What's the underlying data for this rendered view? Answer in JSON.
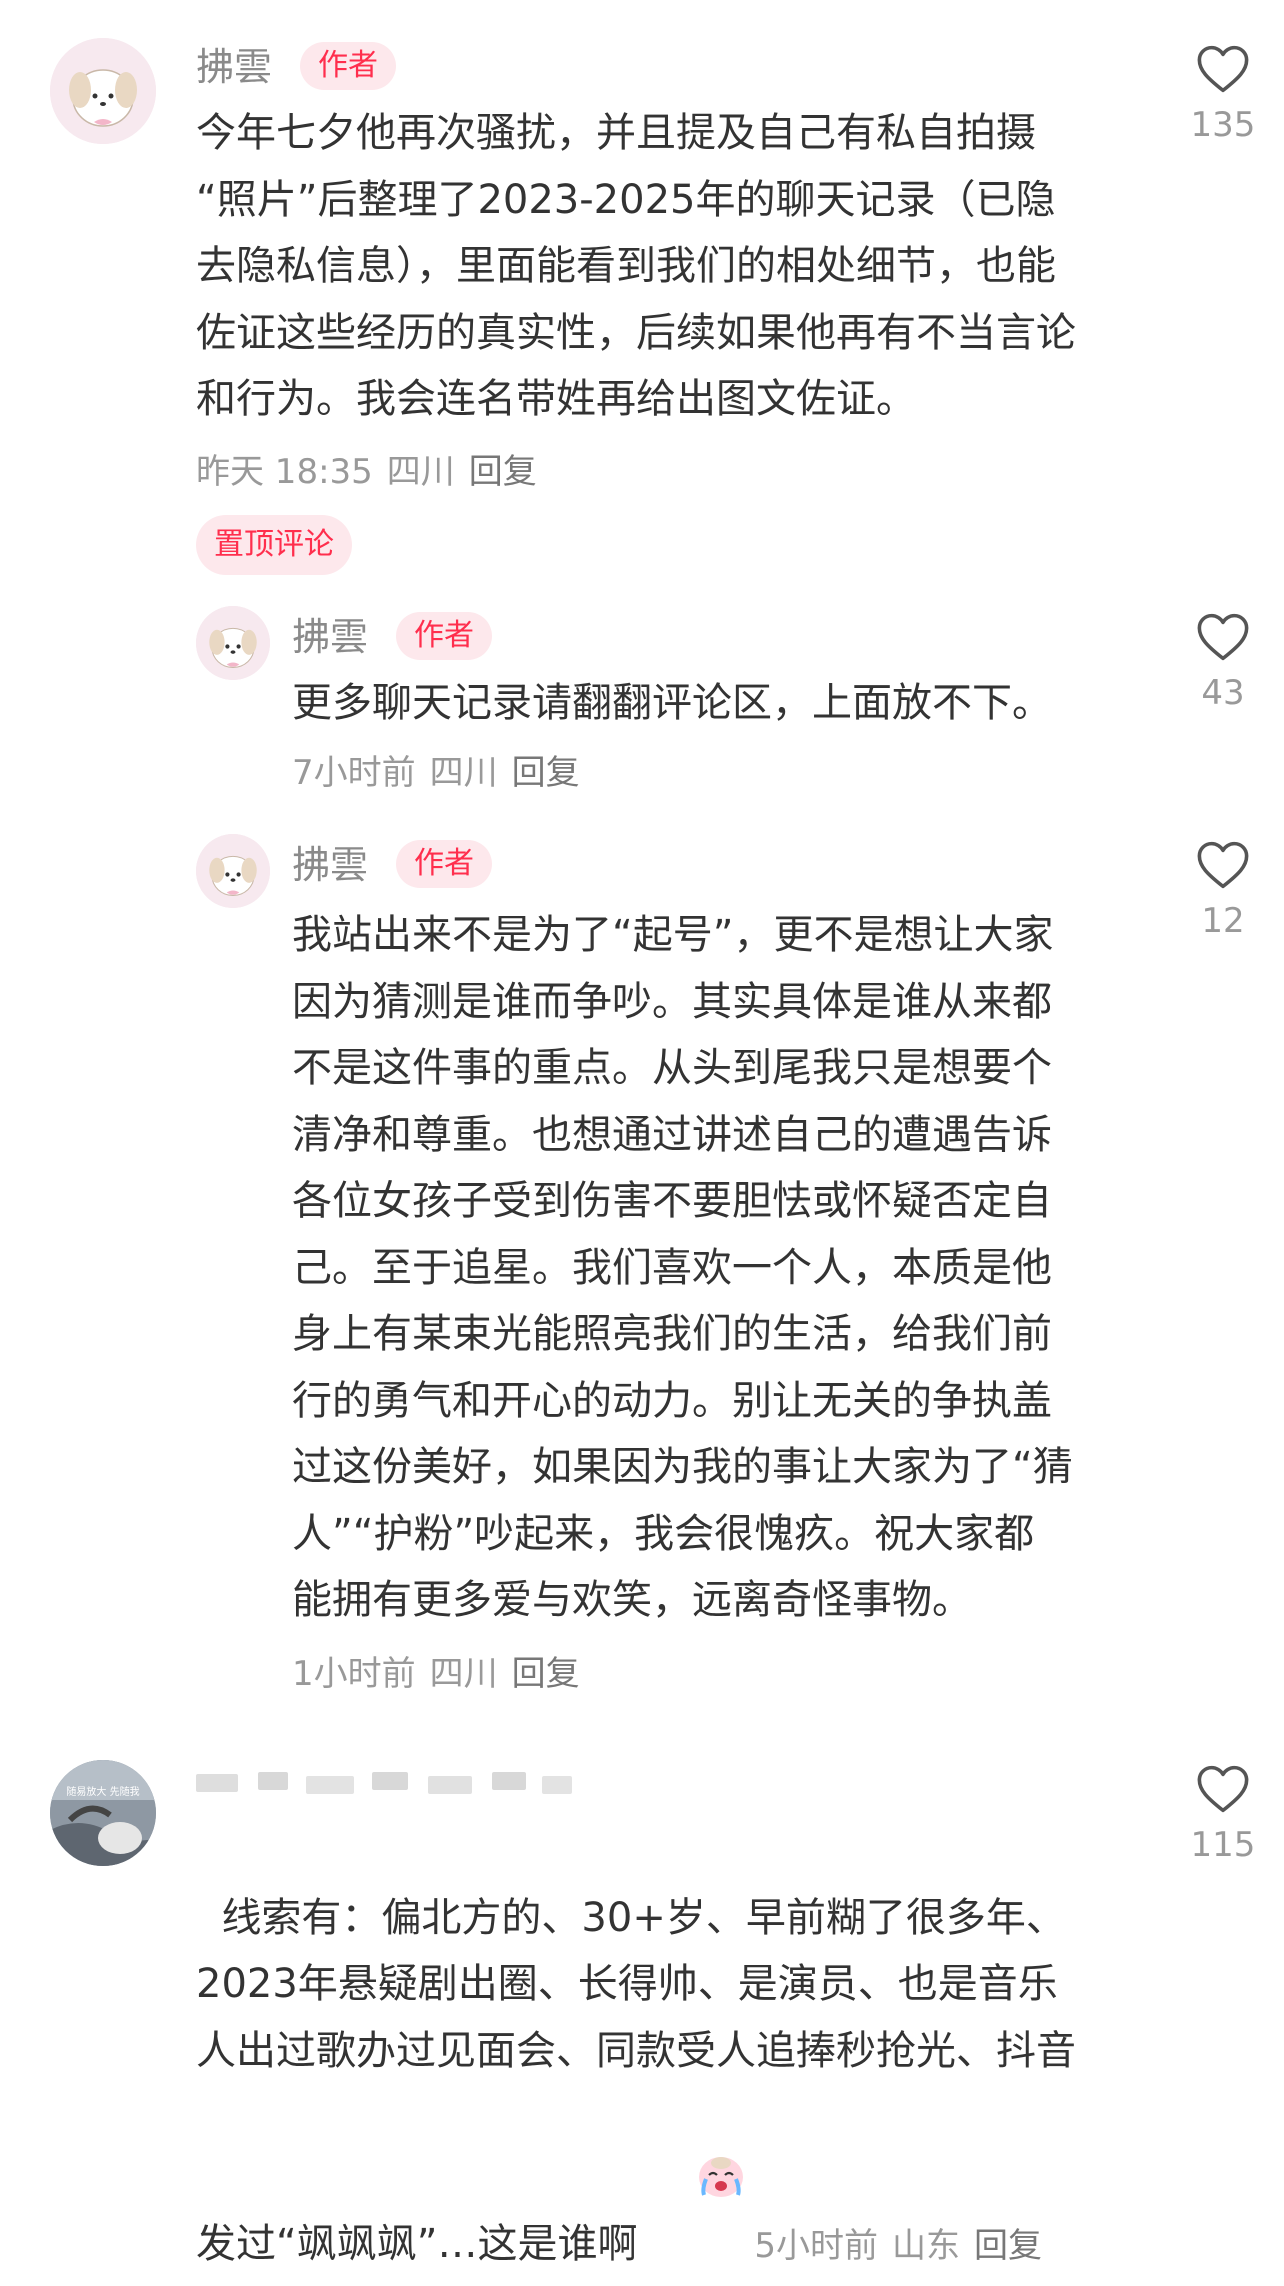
{
  "comments": [
    {
      "author": "拂雲",
      "author_tag": "作者",
      "text": "今年七夕他再次骚扰，并且提及自己有私自拍摄\n“照片”后整理了2023-2025年的聊天记录（已隐\n去隐私信息），里面能看到我们的相处细节，也能\n佐证这些经历的真实性，后续如果他再有不当言论\n和行为。我会连名带姓再给出图文佐证。",
      "time": "昨天 18:35",
      "location": "四川",
      "reply_label": "回复",
      "likes": "135",
      "pinned_label": "置顶评论",
      "replies": [
        {
          "author": "拂雲",
          "author_tag": "作者",
          "text": "更多聊天记录请翻翻评论区，上面放不下。",
          "time": "7小时前",
          "location": "四川",
          "reply_label": "回复",
          "likes": "43"
        },
        {
          "author": "拂雲",
          "author_tag": "作者",
          "text": "我站出来不是为了“起号”，更不是想让大家\n因为猜测是谁而争吵。其实具体是谁从来都\n不是这件事的重点。从头到尾我只是想要个\n清净和尊重。也想通过讲述自己的遭遇告诉\n各位女孩子受到伤害不要胆怯或怀疑否定自\n己。至于追星。我们喜欢一个人，本质是他\n身上有某束光能照亮我们的生活，给我们前\n行的勇气和开心的动力。别让无关的争执盖\n过这份美好，如果因为我的事让大家为了“猜\n人”“护粉”吵起来，我会很愧疚。祝大家都\n能拥有更多爱与欢笑，远离奇怪事物。",
          "time": "1小时前",
          "location": "四川",
          "reply_label": "回复",
          "likes": "12"
        }
      ]
    },
    {
      "text": "线索有：偏北方的、30+岁、早前糊了很多年、\n2023年悬疑剧出圈、长得帅、是演员、也是音乐\n人出过歌办过见面会、同款受人追捧秒抢光、抖音\n发过“飒飒飒”…这是谁啊",
      "time": "5小时前",
      "location": "山东",
      "reply_label": "回复",
      "likes": "115",
      "avatar_caption": "随易放大 先随我"
    }
  ],
  "icons": {
    "like": "heart-outline-icon",
    "emoji": "crying-face-emoji-icon"
  },
  "colors": {
    "accent": "#ff2e4d",
    "tag_bg": "#fde8ec",
    "meta": "#999999"
  }
}
